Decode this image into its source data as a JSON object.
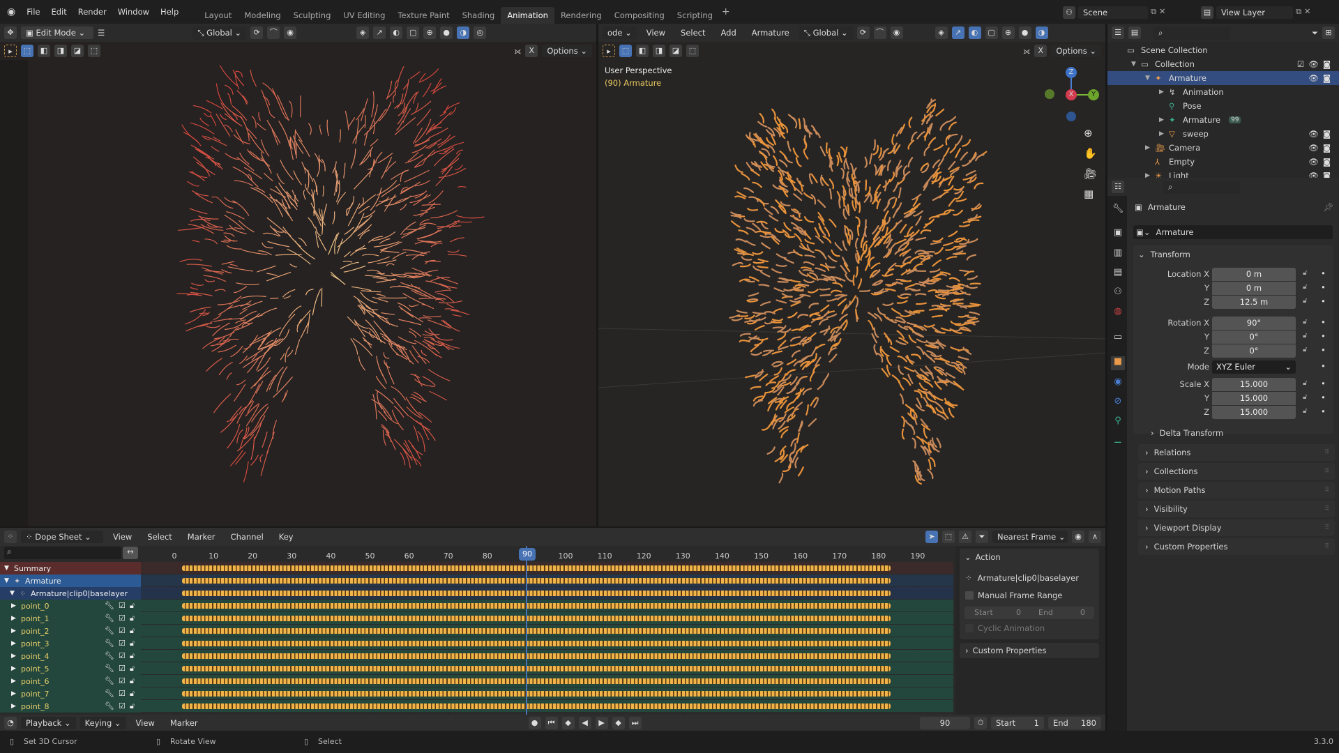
{
  "topbar": {
    "menus": [
      "File",
      "Edit",
      "Render",
      "Window",
      "Help"
    ],
    "workspaces": [
      "Layout",
      "Modeling",
      "Sculpting",
      "UV Editing",
      "Texture Paint",
      "Shading",
      "Animation",
      "Rendering",
      "Compositing",
      "Scripting"
    ],
    "active_workspace": "Animation",
    "add": "+",
    "scene": "Scene",
    "view_layer": "View Layer"
  },
  "left_viewport": {
    "mode": "Edit Mode",
    "orientation": "Global",
    "options": "Options",
    "x_label": "X"
  },
  "right_viewport": {
    "mode": "ode",
    "menus": [
      "View",
      "Select",
      "Add",
      "Armature"
    ],
    "orientation": "Global",
    "options": "Options",
    "x_label": "X",
    "overlay_title": "User Perspective",
    "overlay_object": "(90) Armature",
    "gizmo": {
      "z": "Z",
      "y": "Y",
      "x": "X"
    }
  },
  "outliner": {
    "items": [
      {
        "label": "Scene Collection",
        "depth": 0
      },
      {
        "label": "Collection",
        "depth": 1
      },
      {
        "label": "Armature",
        "depth": 2,
        "selected": true
      },
      {
        "label": "Animation",
        "depth": 3
      },
      {
        "label": "Pose",
        "depth": 3
      },
      {
        "label": "Armature",
        "depth": 3,
        "badge": "99"
      },
      {
        "label": "sweep",
        "depth": 3
      },
      {
        "label": "Camera",
        "depth": 2
      },
      {
        "label": "Empty",
        "depth": 2
      },
      {
        "label": "Light",
        "depth": 2
      }
    ]
  },
  "properties": {
    "object_name": "Armature",
    "datablock": "Armature",
    "transform": "Transform",
    "location": {
      "label": "Location X",
      "x": "0 m",
      "y": "0 m",
      "z": "12.5 m"
    },
    "rotation": {
      "label": "Rotation X",
      "x": "90°",
      "y": "0°",
      "z": "0°"
    },
    "mode": {
      "label": "Mode",
      "value": "XYZ Euler"
    },
    "scale": {
      "label": "Scale X",
      "x": "15.000",
      "y": "15.000",
      "z": "15.000"
    },
    "axis": {
      "y": "Y",
      "z": "Z"
    },
    "delta": "Delta Transform",
    "panels": [
      "Relations",
      "Collections",
      "Motion Paths",
      "Visibility",
      "Viewport Display",
      "Custom Properties"
    ]
  },
  "dopesheet": {
    "editor": "Dope Sheet",
    "menus": [
      "View",
      "Select",
      "Marker",
      "Channel",
      "Key"
    ],
    "snap": "Nearest Frame",
    "ticks": [
      0,
      10,
      20,
      30,
      40,
      50,
      60,
      70,
      80,
      90,
      100,
      110,
      120,
      130,
      140,
      150,
      160,
      170,
      180,
      190
    ],
    "current_frame": 90,
    "key_start": 2,
    "key_end": 183,
    "channels": {
      "summary": "Summary",
      "object": "Armature",
      "action": "Armature|clip0|baselayer",
      "points": [
        "point_0",
        "point_1",
        "point_2",
        "point_3",
        "point_4",
        "point_5",
        "point_6",
        "point_7",
        "point_8"
      ]
    },
    "sidebar": {
      "action_header": "Action",
      "action_name": "Armature|clip0|baselayer",
      "manual_range": "Manual Frame Range",
      "start_label": "Start",
      "start": "0",
      "end_label": "End",
      "end": "0",
      "cyclic": "Cyclic Animation",
      "custom_props": "Custom Properties"
    }
  },
  "timeline": {
    "menus": [
      "Playback",
      "Keying",
      "View",
      "Marker"
    ],
    "frame": "90",
    "start_label": "Start",
    "start": "1",
    "end_label": "End",
    "end": "180"
  },
  "statusbar": {
    "hints": [
      "Set 3D Cursor",
      "Rotate View",
      "Select"
    ],
    "version": "3.3.0"
  }
}
